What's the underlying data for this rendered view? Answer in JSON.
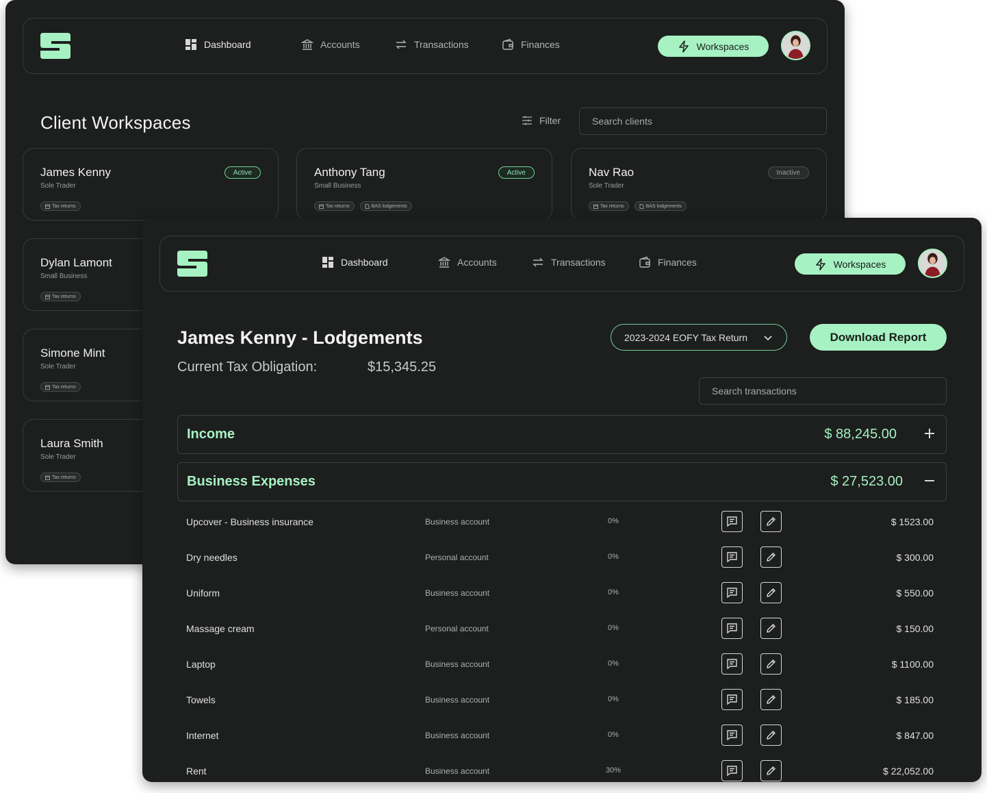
{
  "nav": {
    "items": [
      {
        "label": "Dashboard",
        "icon": "dashboard-icon"
      },
      {
        "label": "Accounts",
        "icon": "bank-icon"
      },
      {
        "label": "Transactions",
        "icon": "arrows-exchange-icon"
      },
      {
        "label": "Finances",
        "icon": "wallet-icon"
      }
    ],
    "workspaces_label": "Workspaces"
  },
  "workspaces": {
    "title": "Client Workspaces",
    "filter_label": "Filter",
    "search_placeholder": "Search clients",
    "clients": [
      {
        "name": "James Kenny",
        "type": "Sole Trader",
        "status": "Active",
        "tags": [
          "Tax returns"
        ]
      },
      {
        "name": "Anthony Tang",
        "type": "Small Business",
        "status": "Active",
        "tags": [
          "Tax returns",
          "BAS lodgements"
        ]
      },
      {
        "name": "Nav Rao",
        "type": "Sole Trader",
        "status": "Inactive",
        "tags": [
          "Tax returns",
          "BAS lodgements"
        ]
      },
      {
        "name": "Dylan Lamont",
        "type": "Small Business",
        "status": "",
        "tags": [
          "Tax returns"
        ]
      },
      {
        "name": "Simone Mint",
        "type": "Sole Trader",
        "status": "",
        "tags": [
          "Tax returns"
        ]
      },
      {
        "name": "Laura Smith",
        "type": "Sole Trader",
        "status": "",
        "tags": [
          "Tax returns"
        ]
      }
    ]
  },
  "lodgements": {
    "title": "James Kenny - Lodgements",
    "obligation_label": "Current Tax Obligation:",
    "obligation_value": "$15,345.25",
    "period": "2023-2024 EOFY Tax Return",
    "download_label": "Download Report",
    "search_placeholder": "Search transactions",
    "sections": [
      {
        "name": "Income",
        "total": "$ 88,245.00",
        "expanded": false
      },
      {
        "name": "Business Expenses",
        "total": "$ 27,523.00",
        "expanded": true
      }
    ],
    "expenses": [
      {
        "name": "Upcover - Business insurance",
        "account": "Business account",
        "percent": "0%",
        "amount": "$ 1523.00"
      },
      {
        "name": "Dry needles",
        "account": "Personal account",
        "percent": "0%",
        "amount": "$ 300.00"
      },
      {
        "name": "Uniform",
        "account": "Business account",
        "percent": "0%",
        "amount": "$ 550.00"
      },
      {
        "name": "Massage cream",
        "account": "Personal account",
        "percent": "0%",
        "amount": "$ 150.00"
      },
      {
        "name": "Laptop",
        "account": "Business account",
        "percent": "0%",
        "amount": "$ 1100.00"
      },
      {
        "name": "Towels",
        "account": "Business account",
        "percent": "0%",
        "amount": "$ 185.00"
      },
      {
        "name": "Internet",
        "account": "Business account",
        "percent": "0%",
        "amount": "$ 847.00"
      },
      {
        "name": "Rent",
        "account": "Business account",
        "percent": "30%",
        "amount": "$ 22,052.00"
      }
    ]
  },
  "colors": {
    "background": "#1d1e1e",
    "accent": "#a6f2c2",
    "border": "#3a3b3b",
    "text": "#e6e6e6",
    "muted": "#a9abaa"
  }
}
